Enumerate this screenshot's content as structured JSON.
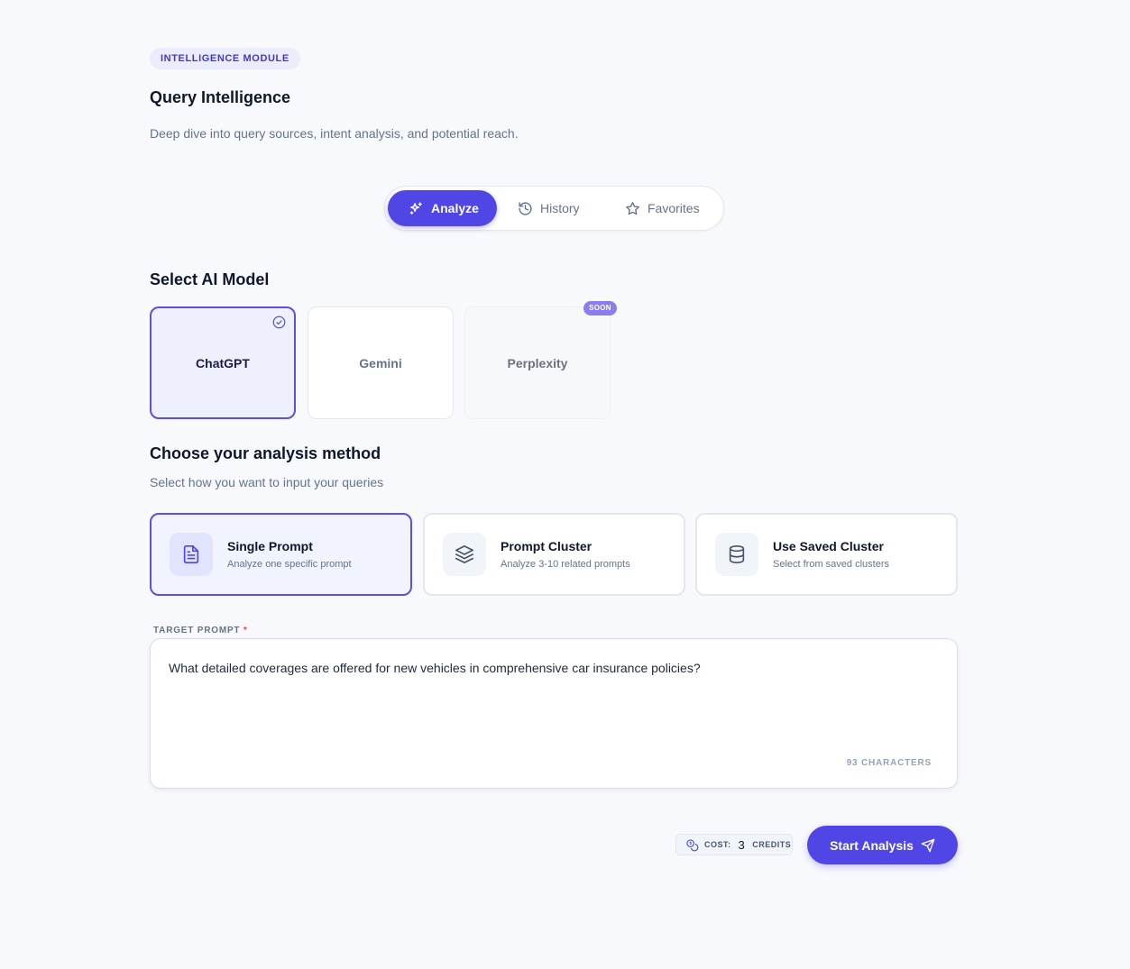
{
  "header": {
    "badge": "INTELLIGENCE MODULE",
    "title": "Query Intelligence",
    "subtitle": "Deep dive into query sources, intent analysis, and potential reach."
  },
  "tabs": [
    {
      "label": "Analyze",
      "icon": "sparkles-icon",
      "active": true
    },
    {
      "label": "History",
      "icon": "history-icon",
      "active": false
    },
    {
      "label": "Favorites",
      "icon": "star-icon",
      "active": false
    }
  ],
  "model_section": {
    "title": "Select AI Model",
    "models": [
      {
        "label": "ChatGPT",
        "selected": true
      },
      {
        "label": "Gemini",
        "selected": false
      },
      {
        "label": "Perplexity",
        "selected": false,
        "badge": "SOON"
      }
    ]
  },
  "method_section": {
    "title": "Choose your analysis method",
    "description": "Select how you want to input your queries",
    "methods": [
      {
        "title": "Single Prompt",
        "description": "Analyze one specific prompt",
        "icon": "document-icon",
        "selected": true
      },
      {
        "title": "Prompt Cluster",
        "description": "Analyze 3-10 related prompts",
        "icon": "layers-icon",
        "selected": false
      },
      {
        "title": "Use Saved Cluster",
        "description": "Select from saved clusters",
        "icon": "database-icon",
        "selected": false
      }
    ]
  },
  "prompt": {
    "label": "TARGET PROMPT",
    "required_mark": "*",
    "value": "What detailed coverages are offered for new vehicles in comprehensive car insurance policies?",
    "char_count": "93 CHARACTERS"
  },
  "footer": {
    "cost_label": "COST:",
    "cost_value": "3",
    "cost_unit": "CREDITS",
    "start_label": "Start Analysis"
  },
  "colors": {
    "accent": "#4f46e5",
    "selected_border": "#5b50e0",
    "soon_badge": "#8b7cf0",
    "background": "#f8f9fc"
  }
}
